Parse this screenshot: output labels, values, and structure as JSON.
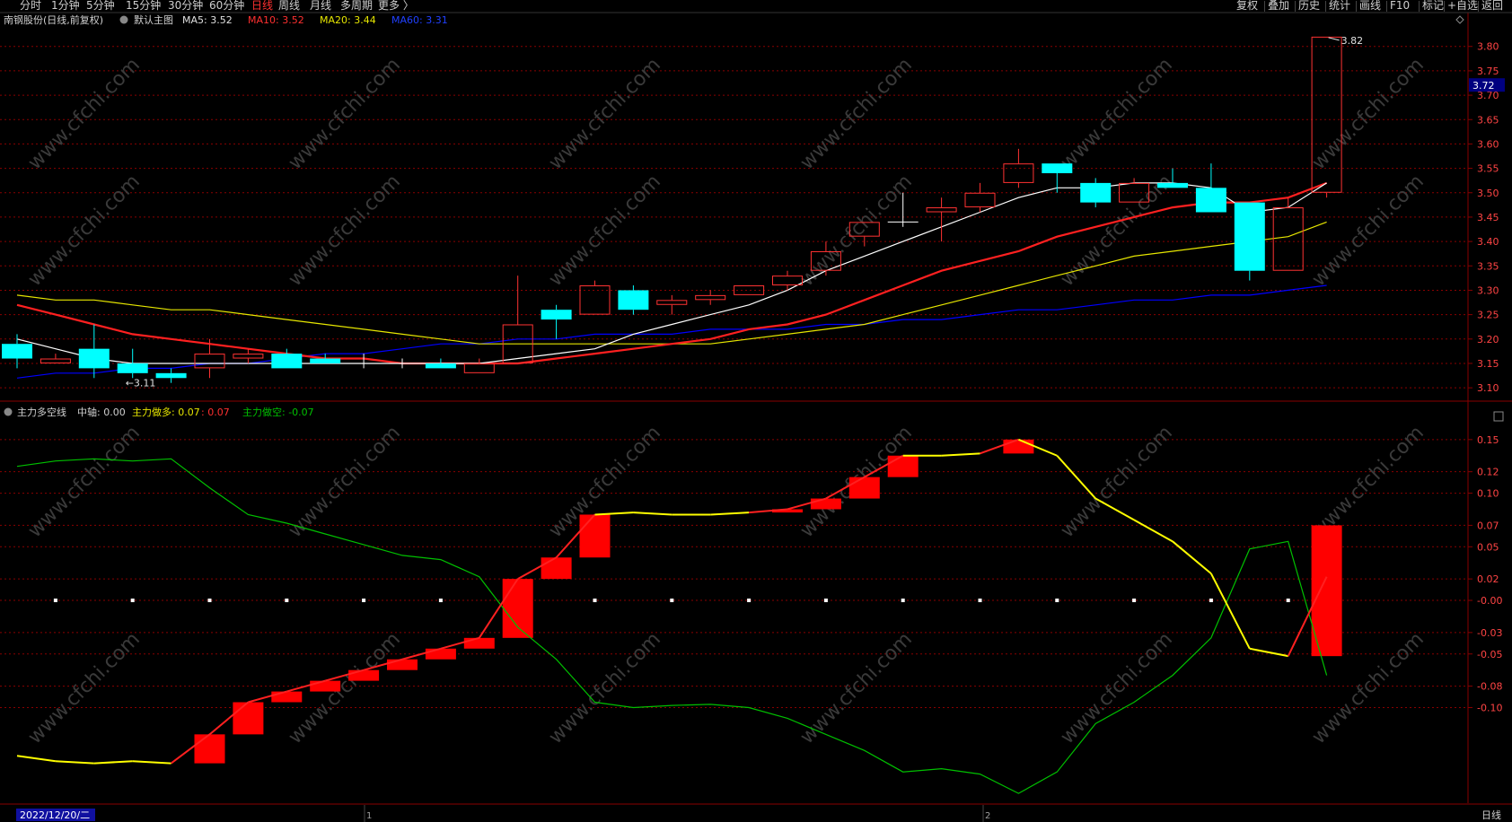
{
  "toolbar": {
    "periods": [
      "分时",
      "1分钟",
      "5分钟",
      "15分钟",
      "30分钟",
      "60分钟",
      "日线",
      "周线",
      "月线",
      "多周期",
      "更多 〉"
    ],
    "active_period": "日线",
    "right": [
      "复权",
      "叠加",
      "历史",
      "统计",
      "画线",
      "F10",
      "标记",
      "+自选",
      "返回"
    ]
  },
  "main_header": {
    "stock": "南钢股份(日线,前复权)",
    "chart_name": "默认主图",
    "ma5_label": "MA5:",
    "ma5_value": "3.52",
    "ma10_label": "MA10:",
    "ma10_value": "3.52",
    "ma20_label": "MA20:",
    "ma20_value": "3.44",
    "ma60_label": "MA60:",
    "ma60_value": "3.31"
  },
  "ind_header": {
    "name": "主力多空线",
    "mid_label": "中轴:",
    "mid_value": "0.00",
    "long_label": "主力做多:",
    "long_value": "0.07",
    "long_value2": ": 0.07",
    "short_label": "主力做空:",
    "short_value": "-0.07"
  },
  "price_badge": "3.72",
  "max_label": "3.82",
  "min_label": "←3.11",
  "bottom": {
    "date_box": "2022/12/20/二",
    "m1": "1",
    "m2": "2",
    "period_label": "日线"
  },
  "watermark": "www.cfchi.com",
  "colors": {
    "up": "#ff3232",
    "down": "#00ffff",
    "ma5": "#ffffff",
    "ma10": "#ff2020",
    "ma20": "#e6e600",
    "ma60": "#0000ff",
    "long_line": "#ffff00",
    "short_line": "#00c000",
    "grid": "#8a0000",
    "axis_text": "#ff4444"
  },
  "chart_data": [
    {
      "type": "candlestick",
      "ylim": [
        3.08,
        3.84
      ],
      "yticks": [
        3.1,
        3.15,
        3.2,
        3.25,
        3.3,
        3.35,
        3.4,
        3.45,
        3.5,
        3.55,
        3.6,
        3.65,
        3.7,
        3.75,
        3.8
      ],
      "candles": [
        {
          "o": 3.19,
          "c": 3.16,
          "h": 3.21,
          "l": 3.14
        },
        {
          "o": 3.15,
          "c": 3.16,
          "h": 3.17,
          "l": 3.15
        },
        {
          "o": 3.18,
          "c": 3.14,
          "h": 3.23,
          "l": 3.12
        },
        {
          "o": 3.15,
          "c": 3.13,
          "h": 3.18,
          "l": 3.12
        },
        {
          "o": 3.13,
          "c": 3.12,
          "h": 3.14,
          "l": 3.11
        },
        {
          "o": 3.14,
          "c": 3.17,
          "h": 3.2,
          "l": 3.12
        },
        {
          "o": 3.16,
          "c": 3.17,
          "h": 3.18,
          "l": 3.15
        },
        {
          "o": 3.17,
          "c": 3.14,
          "h": 3.18,
          "l": 3.14
        },
        {
          "o": 3.16,
          "c": 3.15,
          "h": 3.17,
          "l": 3.15
        },
        {
          "o": 3.15,
          "c": 3.15,
          "h": 3.17,
          "l": 3.14
        },
        {
          "o": 3.15,
          "c": 3.15,
          "h": 3.16,
          "l": 3.14
        },
        {
          "o": 3.15,
          "c": 3.14,
          "h": 3.16,
          "l": 3.14
        },
        {
          "o": 3.13,
          "c": 3.15,
          "h": 3.16,
          "l": 3.13
        },
        {
          "o": 3.15,
          "c": 3.23,
          "h": 3.33,
          "l": 3.15
        },
        {
          "o": 3.26,
          "c": 3.24,
          "h": 3.27,
          "l": 3.2
        },
        {
          "o": 3.25,
          "c": 3.31,
          "h": 3.32,
          "l": 3.25
        },
        {
          "o": 3.3,
          "c": 3.26,
          "h": 3.31,
          "l": 3.25
        },
        {
          "o": 3.27,
          "c": 3.28,
          "h": 3.29,
          "l": 3.25
        },
        {
          "o": 3.28,
          "c": 3.29,
          "h": 3.3,
          "l": 3.27
        },
        {
          "o": 3.29,
          "c": 3.31,
          "h": 3.31,
          "l": 3.29
        },
        {
          "o": 3.31,
          "c": 3.33,
          "h": 3.34,
          "l": 3.3
        },
        {
          "o": 3.34,
          "c": 3.38,
          "h": 3.4,
          "l": 3.33
        },
        {
          "o": 3.41,
          "c": 3.44,
          "h": 3.44,
          "l": 3.39
        },
        {
          "o": 3.44,
          "c": 3.44,
          "h": 3.5,
          "l": 3.43
        },
        {
          "o": 3.46,
          "c": 3.47,
          "h": 3.49,
          "l": 3.4
        },
        {
          "o": 3.47,
          "c": 3.5,
          "h": 3.52,
          "l": 3.46
        },
        {
          "o": 3.52,
          "c": 3.56,
          "h": 3.59,
          "l": 3.51
        },
        {
          "o": 3.56,
          "c": 3.54,
          "h": 3.56,
          "l": 3.5
        },
        {
          "o": 3.52,
          "c": 3.48,
          "h": 3.53,
          "l": 3.47
        },
        {
          "o": 3.48,
          "c": 3.52,
          "h": 3.53,
          "l": 3.48
        },
        {
          "o": 3.52,
          "c": 3.51,
          "h": 3.55,
          "l": 3.51
        },
        {
          "o": 3.51,
          "c": 3.46,
          "h": 3.56,
          "l": 3.46
        },
        {
          "o": 3.48,
          "c": 3.34,
          "h": 3.48,
          "l": 3.32
        },
        {
          "o": 3.34,
          "c": 3.47,
          "h": 3.49,
          "l": 3.34
        },
        {
          "o": 3.5,
          "c": 3.82,
          "h": 3.82,
          "l": 3.49
        }
      ],
      "ma5": [
        3.2,
        3.18,
        3.16,
        3.15,
        3.15,
        3.15,
        3.15,
        3.15,
        3.15,
        3.15,
        3.15,
        3.15,
        3.15,
        3.16,
        3.17,
        3.18,
        3.21,
        3.23,
        3.25,
        3.27,
        3.3,
        3.34,
        3.37,
        3.4,
        3.43,
        3.46,
        3.49,
        3.51,
        3.51,
        3.52,
        3.52,
        3.51,
        3.46,
        3.47,
        3.52
      ],
      "ma10": [
        3.27,
        3.25,
        3.23,
        3.21,
        3.2,
        3.19,
        3.18,
        3.17,
        3.16,
        3.16,
        3.15,
        3.15,
        3.15,
        3.15,
        3.16,
        3.17,
        3.18,
        3.19,
        3.2,
        3.22,
        3.23,
        3.25,
        3.28,
        3.31,
        3.34,
        3.36,
        3.38,
        3.41,
        3.43,
        3.45,
        3.47,
        3.48,
        3.48,
        3.49,
        3.52
      ],
      "ma20": [
        3.29,
        3.28,
        3.28,
        3.27,
        3.26,
        3.26,
        3.25,
        3.24,
        3.23,
        3.22,
        3.21,
        3.2,
        3.19,
        3.19,
        3.19,
        3.19,
        3.19,
        3.19,
        3.19,
        3.2,
        3.21,
        3.22,
        3.23,
        3.25,
        3.27,
        3.29,
        3.31,
        3.33,
        3.35,
        3.37,
        3.38,
        3.39,
        3.4,
        3.41,
        3.44
      ],
      "ma60": [
        3.12,
        3.13,
        3.13,
        3.14,
        3.14,
        3.15,
        3.15,
        3.16,
        3.17,
        3.17,
        3.18,
        3.19,
        3.19,
        3.2,
        3.2,
        3.21,
        3.21,
        3.21,
        3.22,
        3.22,
        3.22,
        3.23,
        3.23,
        3.24,
        3.24,
        3.25,
        3.26,
        3.26,
        3.27,
        3.28,
        3.28,
        3.29,
        3.29,
        3.3,
        3.31
      ]
    },
    {
      "type": "indicator",
      "name": "主力多空线",
      "ylim": [
        -0.19,
        0.18
      ],
      "yticks": [
        0.15,
        0.12,
        0.1,
        0.07,
        0.05,
        0.02,
        0.0,
        -0.03,
        -0.05,
        -0.08,
        -0.1
      ],
      "ytick_labels": [
        "0.15",
        "0.12",
        "0.10",
        "0.07",
        "0.05",
        "0.02",
        "-0.00",
        "-0.03",
        "-0.05",
        "-0.08",
        "-0.10"
      ],
      "long_line": [
        -0.145,
        -0.15,
        -0.152,
        -0.15,
        -0.152,
        -0.125,
        -0.095,
        -0.085,
        -0.075,
        -0.065,
        -0.055,
        -0.045,
        -0.035,
        0.02,
        0.04,
        0.08,
        0.082,
        0.08,
        0.08,
        0.082,
        0.085,
        0.095,
        0.115,
        0.135,
        0.135,
        0.137,
        0.15,
        0.135,
        0.095,
        0.075,
        0.055,
        0.025,
        -0.045,
        -0.052,
        0.022
      ],
      "short_line": [
        0.125,
        0.13,
        0.132,
        0.13,
        0.132,
        0.105,
        0.08,
        0.072,
        0.062,
        0.052,
        0.042,
        0.038,
        0.022,
        -0.025,
        -0.055,
        -0.095,
        -0.1,
        -0.098,
        -0.097,
        -0.1,
        -0.11,
        -0.125,
        -0.14,
        -0.16,
        -0.157,
        -0.162,
        -0.18,
        -0.16,
        -0.115,
        -0.095,
        -0.07,
        -0.035,
        0.048,
        0.055,
        -0.07
      ],
      "mid_dots": 0.0
    }
  ]
}
